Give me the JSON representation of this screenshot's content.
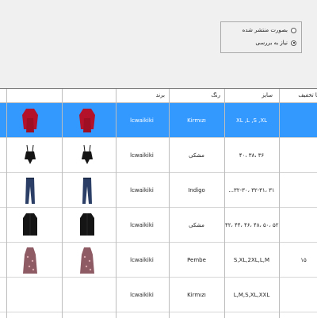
{
  "filter": {
    "options": [
      {
        "label": "بصورت منتشر شده",
        "selected": false
      },
      {
        "label": "نیاز به بررسی",
        "selected": true
      }
    ]
  },
  "table": {
    "headers": {
      "brand": "برند",
      "color": "رنگ",
      "size": "سایز",
      "discount": "با تخفیف"
    },
    "rows": [
      {
        "brand": "lcwaikiki",
        "color": "Kirmızı",
        "sizes": "XL ,L ,S ,XL",
        "garment": "red-blouse",
        "selected": true
      },
      {
        "brand": "lcwaikiki",
        "color": "مشکی",
        "sizes": "۴۰، ۳۸، ۳۶",
        "garment": "black-cami-top",
        "selected": false
      },
      {
        "brand": "lcwaikiki",
        "color": "Indigo",
        "sizes": "...۳۲-۳۰، ۳۲-۳۱، ۳۱",
        "garment": "blue-jeans",
        "selected": false
      },
      {
        "brand": "lcwaikiki",
        "color": "مشکی",
        "sizes": "۴۲، ۴۴، ۴۶، ۴۸، ۵۰، ۵۲",
        "garment": "black-coat",
        "selected": false
      },
      {
        "brand": "lcwaikiki",
        "color": "Pembe",
        "sizes": "S,XL,2XL,L,M",
        "garment": "floral-dress",
        "selected": false
      },
      {
        "brand": "lcwaikiki",
        "color": "Kirmızı",
        "sizes": "L,M,S,XL,XXL",
        "garment": "none",
        "selected": false
      }
    ],
    "discount_partials": [
      "",
      "",
      "",
      "",
      "۱۵",
      ""
    ]
  },
  "colors": {
    "selection": "#3399ff",
    "grid_bg": "#ffffff",
    "window_bg": "#f0f0f0"
  }
}
